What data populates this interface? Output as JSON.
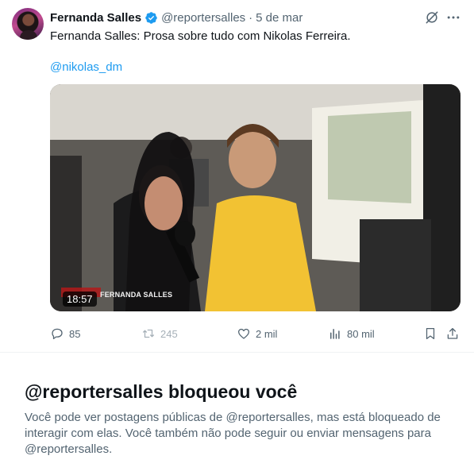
{
  "tweet": {
    "author_name": "Fernanda Salles",
    "handle": "@reportersalles",
    "separator": "·",
    "date": "5 de mar",
    "text": "Fernanda Salles: Prosa sobre tudo com Nikolas Ferreira.",
    "mention": "@nikolas_dm",
    "video": {
      "duration": "18:57",
      "watermark": "FERNANDA SALLES"
    },
    "stats": {
      "replies": "85",
      "retweets": "245",
      "likes": "2 mil",
      "views": "80 mil"
    }
  },
  "blocked": {
    "title": "@reportersalles bloqueou você",
    "body": "Você pode ver postagens públicas de @reportersalles, mas está bloqueado de interagir com elas. Você também não pode seguir ou enviar mensagens para @reportersalles."
  },
  "colors": {
    "accent": "#1d9bf0",
    "secondary_text": "#536471",
    "primary_text": "#0f1419"
  }
}
